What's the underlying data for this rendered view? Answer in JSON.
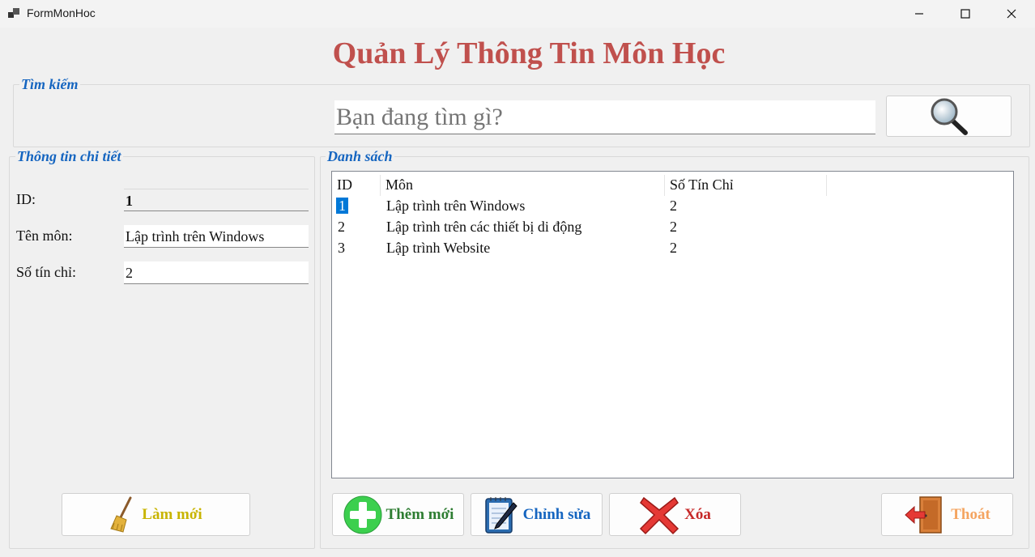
{
  "window": {
    "title": "FormMonHoc"
  },
  "heading": "Quản Lý Thông Tin Môn Học",
  "search": {
    "legend": "Tìm kiếm",
    "placeholder": "Bạn đang tìm gì?"
  },
  "detail": {
    "legend": "Thông tin chi tiết",
    "id_label": "ID:",
    "id_value": "1",
    "name_label": "Tên môn:",
    "name_value": "Lập trình trên Windows",
    "credits_label": "Số tín chỉ:",
    "credits_value": "2",
    "refresh_label": "Làm mới"
  },
  "list": {
    "legend": "Danh sách",
    "columns": [
      "ID",
      "Môn",
      "Số Tín Chỉ"
    ],
    "rows": [
      [
        "1",
        "Lập trình trên Windows",
        "2"
      ],
      [
        "2",
        "Lập trình trên các thiết bị di động",
        "2"
      ],
      [
        "3",
        "Lập trình Website",
        "2"
      ]
    ],
    "selected_row": 0
  },
  "actions": {
    "add": "Thêm mới",
    "edit": "Chỉnh sửa",
    "delete": "Xóa",
    "exit": "Thoát"
  },
  "colors": {
    "heading": "#c0504d",
    "legend": "#1565c0",
    "add": "#2e7d32",
    "edit": "#1565c0",
    "delete": "#c62828",
    "exit": "#f4a460",
    "refresh": "#c8b400",
    "selection": "#0078d7"
  }
}
